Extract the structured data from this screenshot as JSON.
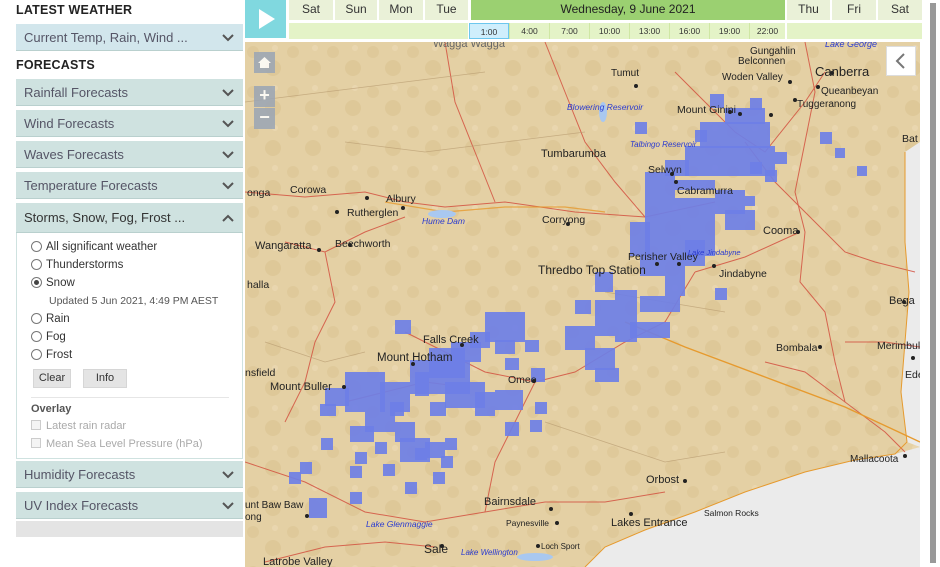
{
  "sidebar": {
    "latest_title": "LATEST WEATHER",
    "current_label": "Current Temp, Rain, Wind ...",
    "forecasts_title": "FORECASTS",
    "items": [
      {
        "label": "Rainfall Forecasts"
      },
      {
        "label": "Wind Forecasts"
      },
      {
        "label": "Waves Forecasts"
      },
      {
        "label": "Temperature Forecasts"
      },
      {
        "label": "Storms, Snow, Fog, Frost ..."
      },
      {
        "label": "Humidity Forecasts"
      },
      {
        "label": "UV Index Forecasts"
      }
    ],
    "storms": {
      "options": [
        {
          "label": "All significant weather",
          "checked": false
        },
        {
          "label": "Thunderstorms",
          "checked": false
        },
        {
          "label": "Snow",
          "checked": true
        },
        {
          "label": "Rain",
          "checked": false
        },
        {
          "label": "Fog",
          "checked": false
        },
        {
          "label": "Frost",
          "checked": false
        }
      ],
      "updated": "Updated 5 Jun 2021, 4:49 PM AEST",
      "clear_label": "Clear",
      "info_label": "Info",
      "overlay_title": "Overlay",
      "overlay_options": [
        {
          "label": "Latest rain radar"
        },
        {
          "label": "Mean Sea Level Pressure (hPa)"
        }
      ]
    }
  },
  "timeline": {
    "days": [
      "Sat",
      "Sun",
      "Mon",
      "Tue",
      "Wednesday, 9 June 2021",
      "Thu",
      "Fri",
      "Sat"
    ],
    "active_day": "Wednesday, 9 June 2021",
    "hours": [
      "1:00",
      "4:00",
      "7:00",
      "10:00",
      "13:00",
      "16:00",
      "19:00",
      "22:00"
    ],
    "selected_hour": "1:00"
  },
  "map": {
    "zoom_in": "+",
    "zoom_out": "−",
    "snow_color": "#6e7fe6",
    "places": [
      "Wagga Wagga",
      "Gungahlin",
      "Belconnen",
      "Lake George",
      "Tumut",
      "Woden Valley",
      "Canberra",
      "Queanbeyan",
      "Tuggeranong",
      "Blowering Reservoir",
      "Mount Ginini",
      "Talbingo Reservoir",
      "Tumbarumba",
      "Selwyn",
      "Cabramurra",
      "Corowa",
      "Albury",
      "Rutherglen",
      "Hume Dam",
      "Corryong",
      "Wangaratta",
      "Beechworth",
      "Perisher Valley",
      "Lake Jindabyne",
      "Thredbo Top Station",
      "Jindabyne",
      "Cooma",
      "Falls Creek",
      "Mount Hotham",
      "Omeo",
      "Mount Buller",
      "Bombala",
      "Bega",
      "Merimbula",
      "Orbost",
      "Mallacoota",
      "Bairnsdale",
      "Paynesville",
      "Lakes Entrance",
      "Salmon Rocks",
      "Lake Glenmaggie",
      "Sale",
      "Lake Wellington",
      "Loch Sport",
      "Latrobe Valley",
      "Mount Baw Baw",
      "Eden",
      "Bat",
      "onga",
      "halla",
      "nsfield",
      "ong"
    ]
  }
}
